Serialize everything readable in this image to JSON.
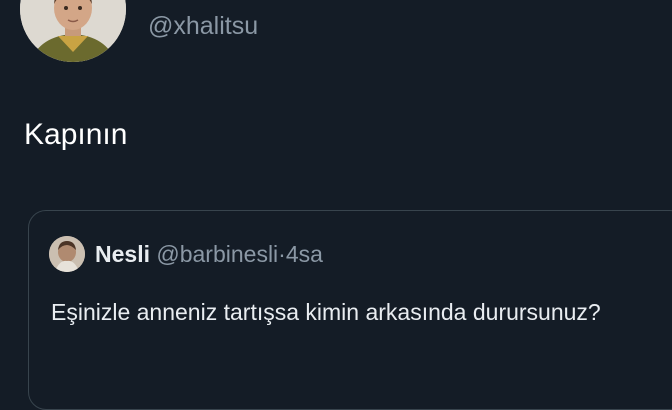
{
  "tweet": {
    "display_name": "",
    "handle": "@xhalitsu",
    "text": "Kapının",
    "avatar_icon": "user-avatar-child-photo"
  },
  "quoted_tweet": {
    "display_name": "Nesli",
    "handle": "@barbinesli",
    "separator": "·",
    "time": "4sa",
    "text": "Eşinizle anneniz tartışsa kimin arkasında durursunuz?",
    "avatar_icon": "user-avatar-photo"
  },
  "colors": {
    "background": "#141c26",
    "primary_text": "#ffffff",
    "secondary_text": "#8b98a5",
    "border": "#38444d"
  }
}
